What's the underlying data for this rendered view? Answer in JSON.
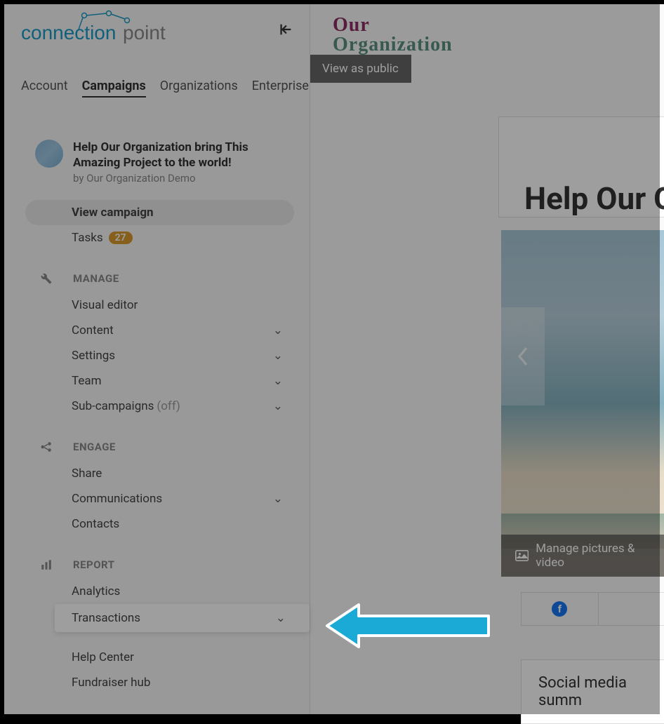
{
  "logo": {
    "text1": "connection",
    "text2": "point"
  },
  "tabs": [
    {
      "label": "Account",
      "active": false
    },
    {
      "label": "Campaigns",
      "active": true
    },
    {
      "label": "Organizations",
      "active": false
    },
    {
      "label": "Enterprise",
      "active": false
    }
  ],
  "campaign": {
    "title": "Help Our Organization bring This Amazing Project to the world!",
    "by": "by Our Organization Demo"
  },
  "nav": {
    "view_campaign": "View campaign",
    "tasks": "Tasks",
    "tasks_count": "27"
  },
  "sections": {
    "manage": {
      "header": "MANAGE",
      "items": {
        "visual_editor": "Visual editor",
        "content": "Content",
        "settings": "Settings",
        "team": "Team",
        "sub_campaigns": "Sub-campaigns",
        "sub_campaigns_off": "(off)"
      }
    },
    "engage": {
      "header": "ENGAGE",
      "items": {
        "share": "Share",
        "communications": "Communications",
        "contacts": "Contacts"
      }
    },
    "report": {
      "header": "REPORT",
      "items": {
        "analytics": "Analytics",
        "transactions": "Transactions"
      }
    },
    "footer": {
      "help_center": "Help Center",
      "fundraiser_hub": "Fundraiser hub"
    }
  },
  "main": {
    "org_line1": "Our",
    "org_line2": "Organization",
    "view_as_public": "View as public",
    "title": "Help Our O",
    "manage_pictures": "Manage pictures & video",
    "social_summary": "Social media summ"
  }
}
